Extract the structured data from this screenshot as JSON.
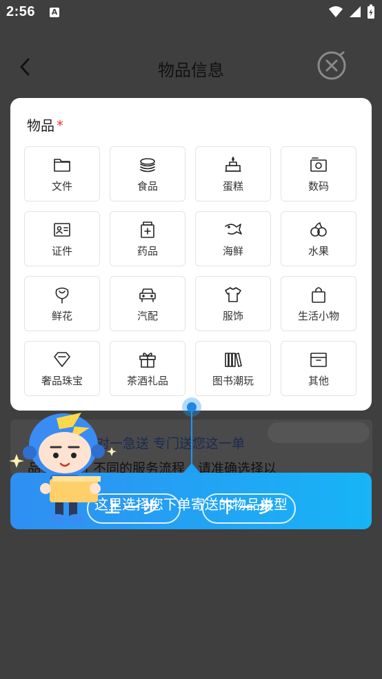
{
  "status_bar": {
    "time": "2:56",
    "notification_icon": "A"
  },
  "header": {
    "title": "物品信息"
  },
  "card": {
    "label": "物品",
    "required_mark": "*",
    "items": [
      {
        "label": "文件",
        "icon": "folder-icon"
      },
      {
        "label": "食品",
        "icon": "food-icon"
      },
      {
        "label": "蛋糕",
        "icon": "cake-icon"
      },
      {
        "label": "数码",
        "icon": "camera-icon"
      },
      {
        "label": "证件",
        "icon": "id-card-icon"
      },
      {
        "label": "药品",
        "icon": "medicine-icon"
      },
      {
        "label": "海鲜",
        "icon": "fish-icon"
      },
      {
        "label": "水果",
        "icon": "fruit-icon"
      },
      {
        "label": "鲜花",
        "icon": "flower-icon"
      },
      {
        "label": "汽配",
        "icon": "car-icon"
      },
      {
        "label": "服饰",
        "icon": "shirt-icon"
      },
      {
        "label": "生活小物",
        "icon": "bag-icon"
      },
      {
        "label": "奢品珠宝",
        "icon": "diamond-icon"
      },
      {
        "label": "茶酒礼品",
        "icon": "gift-icon"
      },
      {
        "label": "图书潮玩",
        "icon": "books-icon"
      },
      {
        "label": "其他",
        "icon": "box-icon"
      }
    ]
  },
  "background": {
    "line1": "对一急送 专门送您这一单",
    "line2": "品类提供了不同的服务流程，请准确选择以"
  },
  "guide": {
    "tip": "这里选择您下单寄送的物品类型",
    "prev": "上一步",
    "next": "下一步"
  }
}
